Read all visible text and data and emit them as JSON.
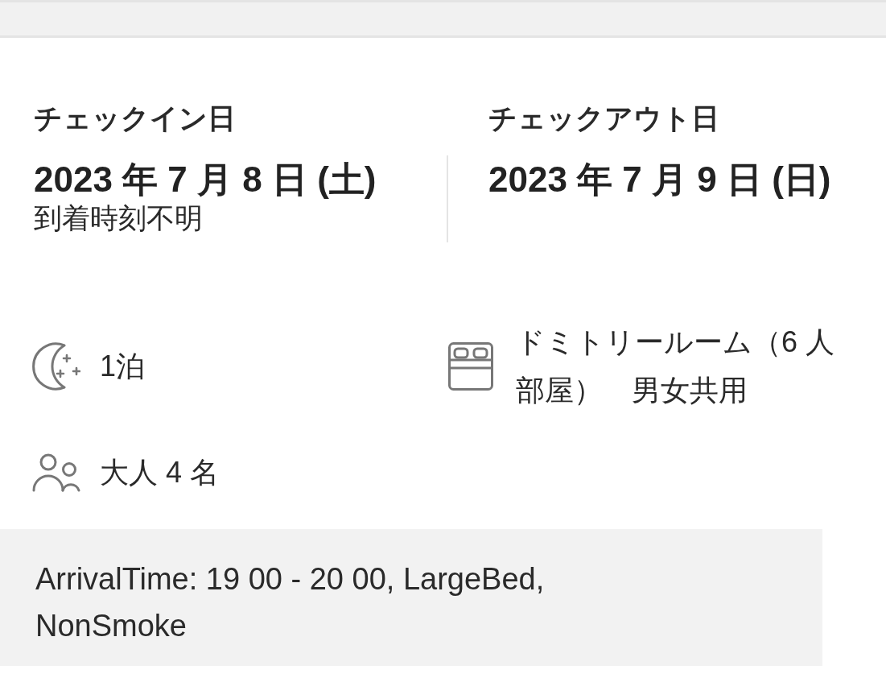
{
  "check_in": {
    "label": "チェックイン日",
    "date": "2023 年 7 月 8 日 (土)",
    "arrival": "到着時刻不明"
  },
  "check_out": {
    "label": "チェックアウト日",
    "date": "2023 年 7 月 9 日 (日)"
  },
  "details": [
    {
      "kind": "nights",
      "text": "1泊"
    },
    {
      "kind": "room",
      "text": "ドミトリールーム（6 人部屋）　男女共用"
    },
    {
      "kind": "guests",
      "text": "大人 4 名"
    }
  ],
  "note": "ArrivalTime: 19 00 - 20 00, LargeBed, NonSmoke"
}
